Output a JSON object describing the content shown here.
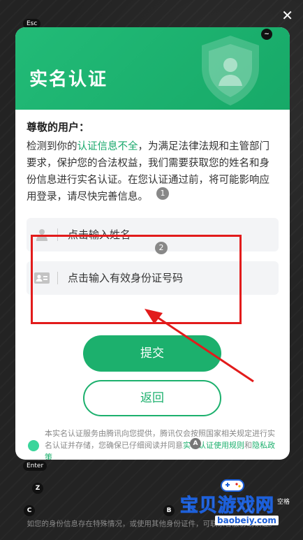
{
  "overlay": {
    "close_glyph": "✕",
    "keys": {
      "esc": "Esc",
      "tilde": "~",
      "enter": "Enter",
      "z": "Z",
      "c": "C",
      "b": "B",
      "a": "A",
      "space": "空格"
    },
    "badges": {
      "one": "1",
      "two": "2"
    }
  },
  "dialog": {
    "title": "实名认证",
    "greeting": "尊敬的用户：",
    "notice_before": "检测到你的",
    "notice_highlight": "认证信息不全",
    "notice_after": "，为满足法律法规和主管部门要求，保护您的合法权益，我们需要获取您的姓名和身份信息进行实名认证。在您认证通过前，将可能影响应用登录，请尽快完善信息。",
    "name_placeholder": "点击输入姓名",
    "id_placeholder": "点击输入有效身份证号码",
    "submit_label": "提交",
    "back_label": "返回",
    "agree_text": "本实名认证服务由腾讯向您提供，腾讯仅会按照国家相关规定进行实名认证并存储，您确保已仔细阅读并同意",
    "agree_link": "实名认证使用规则",
    "agree_and": "和",
    "privacy_link": "隐私政策"
  },
  "footer": {
    "note": "如您的身份信息存在特殊情况，或使用其他身份证件，可联系客服协助认证。"
  },
  "watermark": {
    "title": "宝贝游戏网",
    "url": "baobeiy.com"
  },
  "colors": {
    "primary": "#1cb06d",
    "header": "#22bb77",
    "highlight_box": "#e21b1b"
  }
}
